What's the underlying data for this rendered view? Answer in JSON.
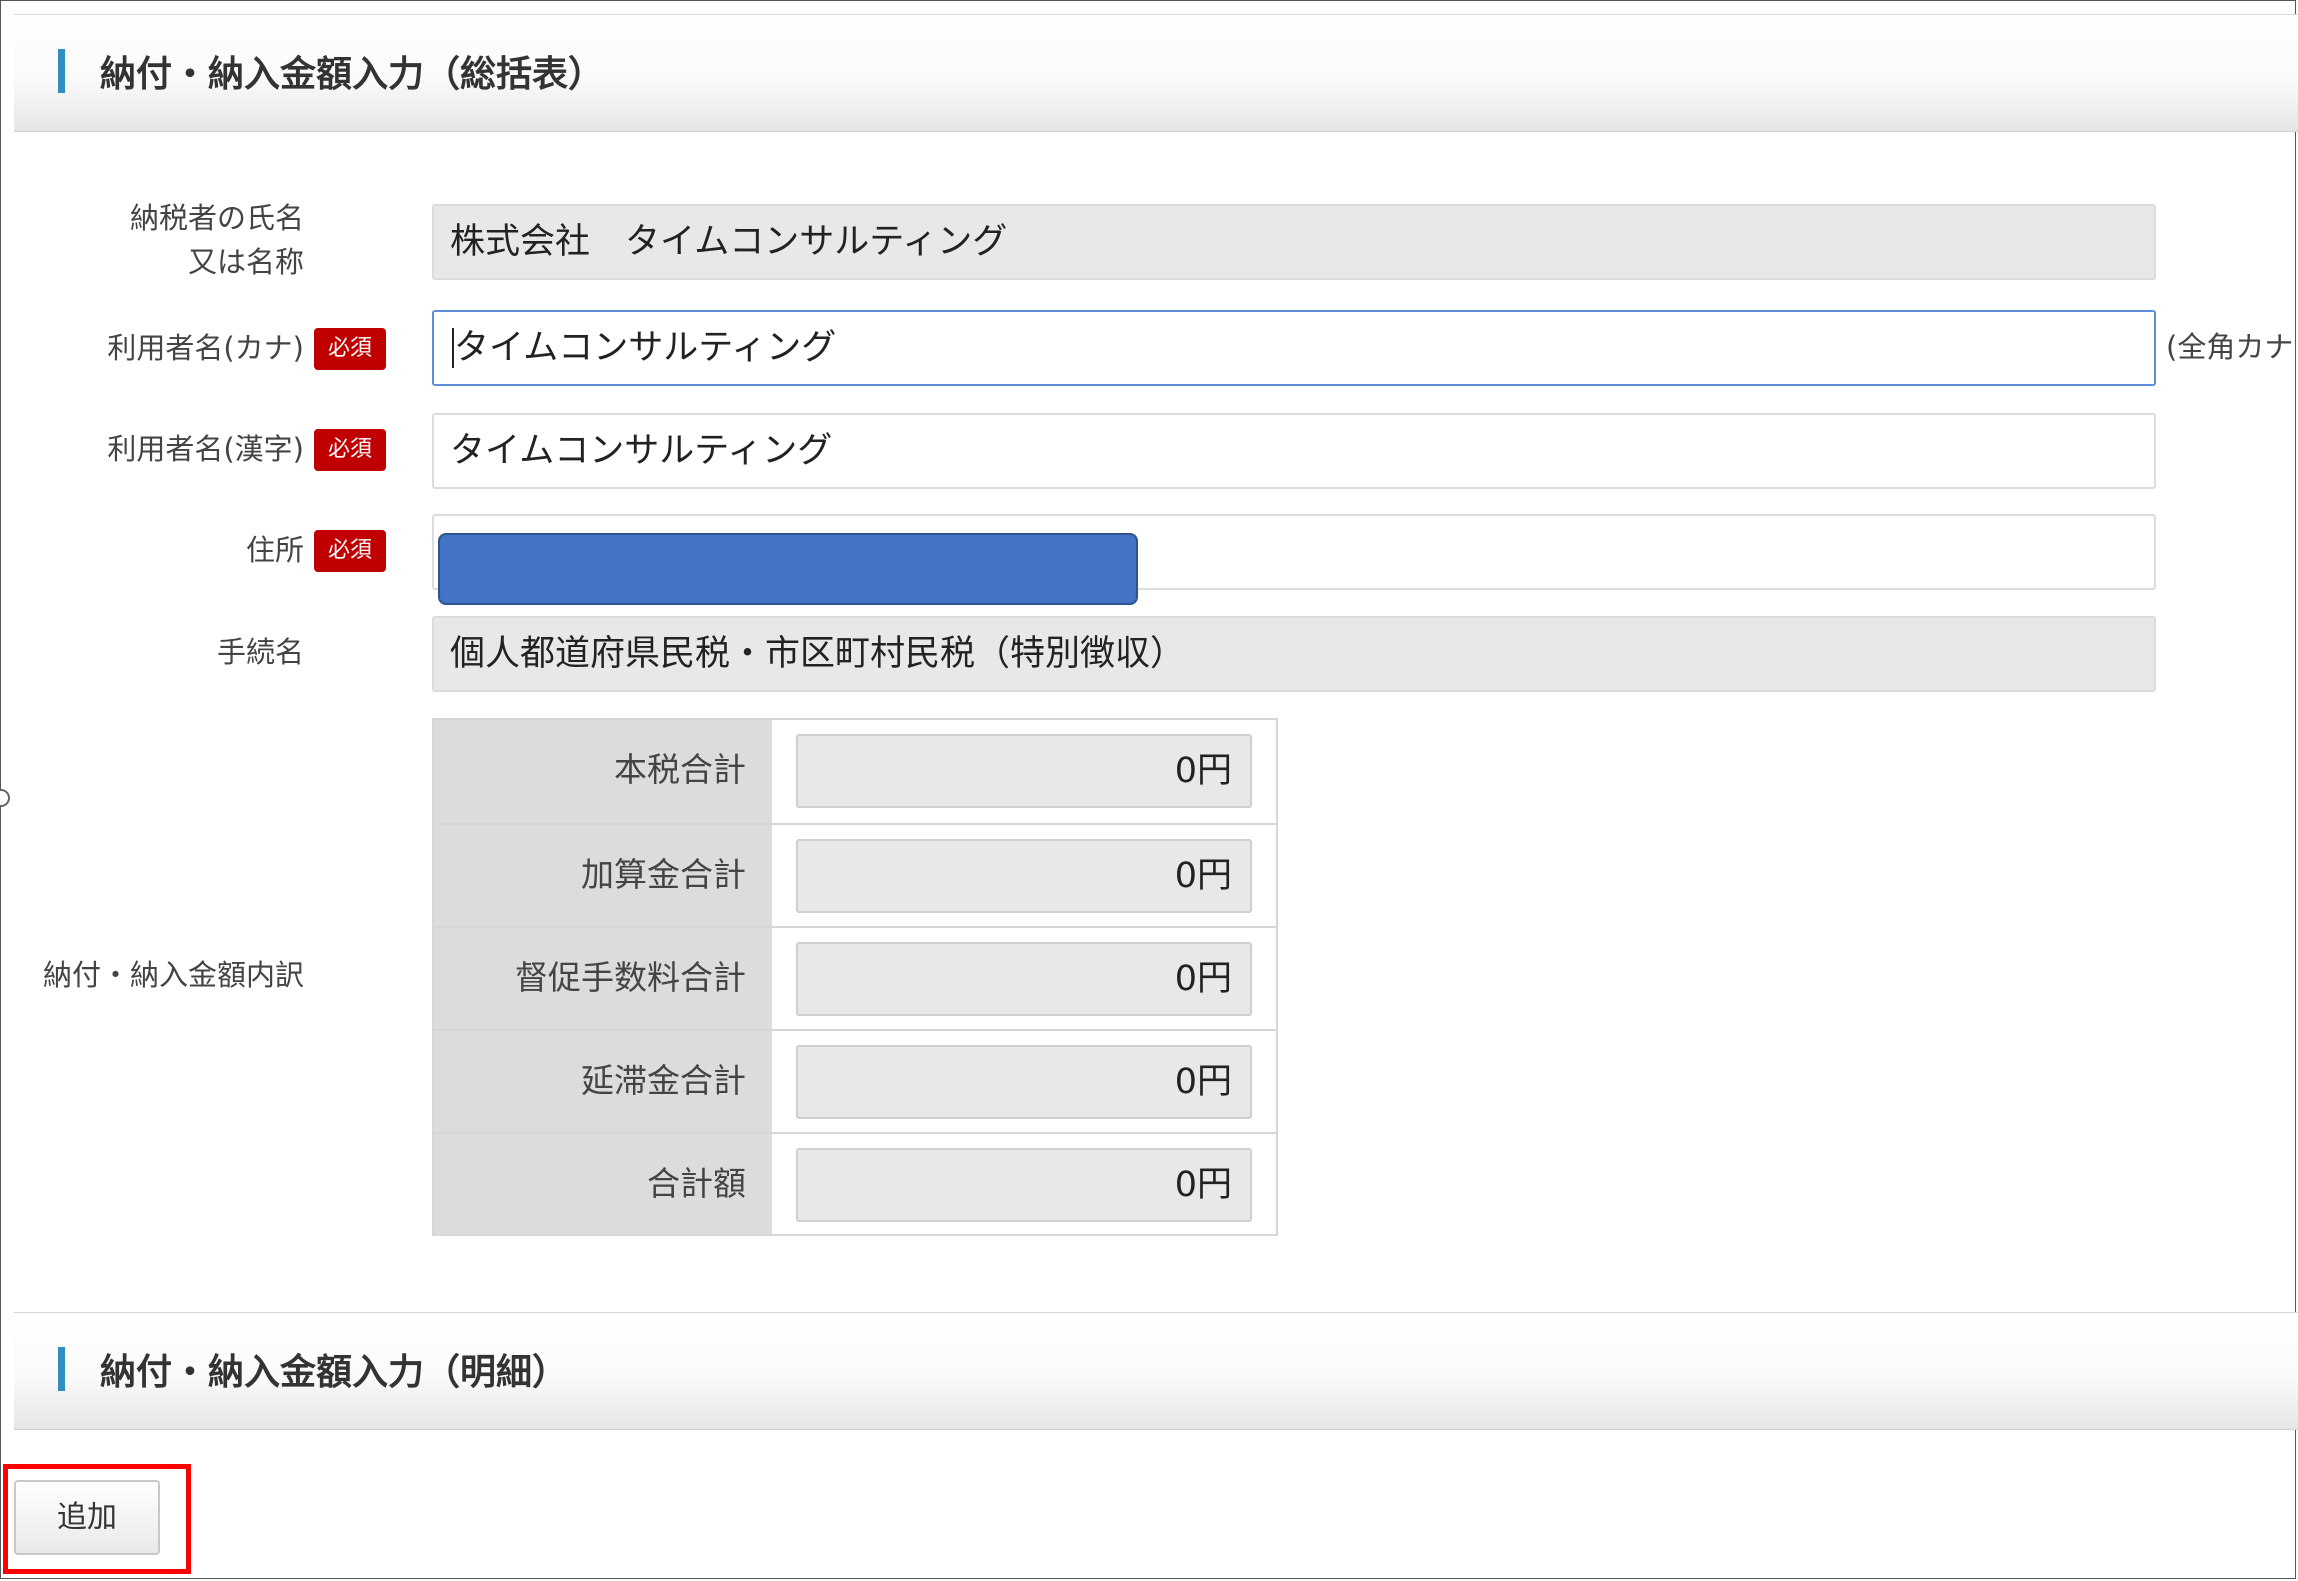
{
  "sections": {
    "summary_title": "納付・納入金額入力（総括表）",
    "detail_title": "納付・納入金額入力（明細）"
  },
  "form": {
    "taxpayer_label_line1": "納税者の氏名",
    "taxpayer_label_line2": "又は名称",
    "taxpayer_value": "株式会社　タイムコンサルティング",
    "user_kana_label": "利用者名(カナ)",
    "user_kana_value": "タイムコンサルティング",
    "user_kana_hint": "(全角カナ",
    "user_kanji_label": "利用者名(漢字)",
    "user_kanji_value": "タイムコンサルティング",
    "address_label": "住所",
    "procedure_label": "手続名",
    "procedure_value": "個人都道府県民税・市区町村民税（特別徴収）",
    "required_badge": "必須"
  },
  "breakdown": {
    "label": "納付・納入金額内訳",
    "rows": [
      {
        "label": "本税合計",
        "value": "0円"
      },
      {
        "label": "加算金合計",
        "value": "0円"
      },
      {
        "label": "督促手数料合計",
        "value": "0円"
      },
      {
        "label": "延滞金合計",
        "value": "0円"
      },
      {
        "label": "合計額",
        "value": "0円"
      }
    ]
  },
  "actions": {
    "add_label": "追加"
  },
  "colors": {
    "accent_bar": "#2f8fc0",
    "required_badge": "#c00000",
    "redaction": "#4472c4",
    "highlight_box": "#ff0000",
    "focus_border": "#5b8fd8"
  }
}
